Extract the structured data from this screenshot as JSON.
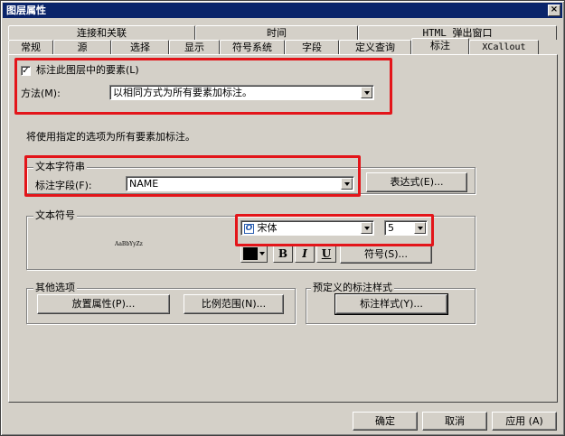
{
  "window": {
    "title": "图层属性",
    "close_glyph": "×"
  },
  "tabs": {
    "back_row": [
      "连接和关联",
      "时间",
      "HTML 弹出窗口"
    ],
    "front_row": [
      "常规",
      "源",
      "选择",
      "显示",
      "符号系统",
      "字段",
      "定义查询",
      "标注",
      "XCallout"
    ],
    "active": "标注"
  },
  "label_panel": {
    "label_features_checkbox": {
      "label": "标注此图层中的要素(L)",
      "checked": true,
      "glyph": "✓"
    },
    "method": {
      "label": "方法(M):",
      "value": "以相同方式为所有要素加标注。"
    },
    "info_text": "将使用指定的选项为所有要素加标注。",
    "text_string": {
      "title": "文本字符串",
      "field_label": "标注字段(F):",
      "field_value": "NAME",
      "expression_button": "表达式(E)..."
    },
    "text_symbol": {
      "title": "文本符号",
      "preview_text": "AaBbYyZz",
      "font_icon_glyph": "O",
      "font": "宋体",
      "size": "5",
      "color": "#000000",
      "bold": "B",
      "italic": "I",
      "underline": "U",
      "symbol_button": "符号(S)..."
    },
    "other_options": {
      "title": "其他选项",
      "placement_button": "放置属性(P)...",
      "scale_button": "比例范围(N)..."
    },
    "predefined_styles": {
      "title": "预定义的标注样式",
      "style_button": "标注样式(Y)..."
    }
  },
  "footer": {
    "ok": "确定",
    "cancel": "取消",
    "apply": "应用 (A)"
  },
  "colors": {
    "highlight": "#e3151a",
    "titlebar": "#0a246a",
    "face": "#d4d0c8"
  }
}
